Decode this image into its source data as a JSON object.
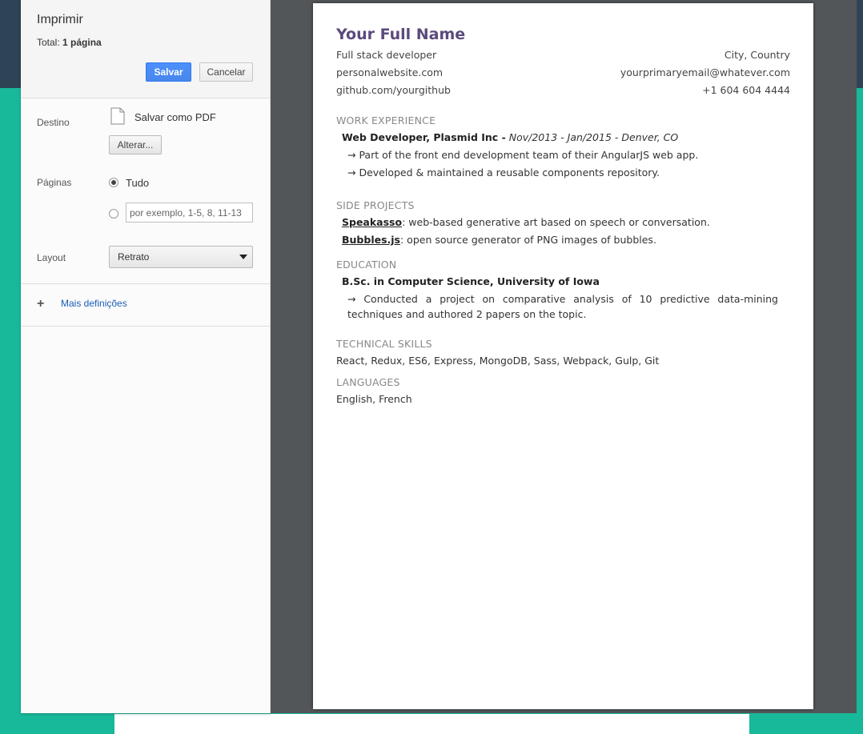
{
  "print_panel": {
    "title": "Imprimir",
    "total_label": "Total:",
    "total_value": "1 página",
    "save_label": "Salvar",
    "cancel_label": "Cancelar",
    "destination_label": "Destino",
    "destination_value": "Salvar como PDF",
    "change_label": "Alterar...",
    "pages_label": "Páginas",
    "pages_all_label": "Tudo",
    "pages_range_placeholder": "por exemplo, 1-5, 8, 11-13",
    "layout_label": "Layout",
    "layout_value": "Retrato",
    "more_settings_label": "Mais definições",
    "accent_color": "#4d90fe"
  },
  "resume": {
    "name": "Your Full Name",
    "role": "Full stack developer",
    "location": "City, Country",
    "website": "personalwebsite.com",
    "email": "yourprimaryemail@whatever.com",
    "github": "github.com/yourgithub",
    "phone": "+1 604 604 4444",
    "work_heading": "WORK EXPERIENCE",
    "work_title": "Web Developer, Plasmid Inc -",
    "work_dates": "Nov/2013 - Jan/2015 - Denver, CO",
    "work_bullets": [
      "→  Part of the front end development team of their AngularJS web app.",
      "→  Developed & maintained a reusable components repository."
    ],
    "side_heading": "SIDE PROJECTS",
    "side_projects": [
      {
        "name": "Speakasso",
        "desc": ": web-based generative art based on speech or conversation."
      },
      {
        "name": "Bubbles.js",
        "desc": ": open source generator of PNG images of bubbles."
      }
    ],
    "education_heading": "EDUCATION",
    "education_title": "B.Sc. in Computer Science, University of Iowa",
    "education_bullet": "→  Conducted a project on comparative analysis of 10 predictive data-mining techniques and authored 2 papers on the topic.",
    "skills_heading": "TECHNICAL SKILLS",
    "skills": "React, Redux, ES6, Express, MongoDB, Sass, Webpack, Gulp, Git",
    "languages_heading": "LANGUAGES",
    "languages": "English, French",
    "name_color": "#5b4a7c"
  }
}
